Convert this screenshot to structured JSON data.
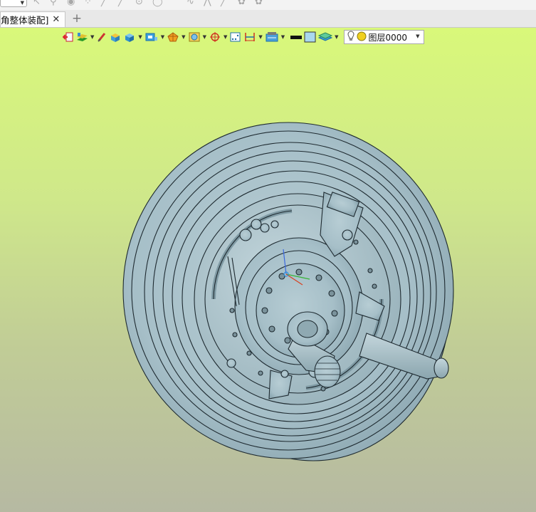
{
  "tabs": {
    "active_label": "角整体装配]",
    "close_glyph": "✕",
    "new_tab_glyph": "+"
  },
  "view_toolbar": {
    "buttons": [
      {
        "name": "exit-sketch-icon"
      },
      {
        "name": "layer-manager-icon",
        "dropdown": true
      },
      {
        "name": "eraser-icon"
      },
      {
        "name": "solid-box-icon"
      },
      {
        "name": "view-cube-icon",
        "dropdown": true
      },
      {
        "name": "display-style-icon",
        "dropdown": true
      },
      {
        "name": "render-mode-icon",
        "dropdown": true
      },
      {
        "name": "section-view-icon",
        "dropdown": true
      },
      {
        "name": "snap-point-icon",
        "dropdown": true
      },
      {
        "name": "grid-toggle-icon"
      },
      {
        "name": "dimension-icon",
        "dropdown": true
      },
      {
        "name": "layer-filter-icon",
        "dropdown": true
      },
      {
        "name": "line-color-icon"
      },
      {
        "name": "face-color-icon"
      },
      {
        "name": "workplane-icon",
        "dropdown": true
      }
    ],
    "layer": {
      "name": "图层0000",
      "bulb_icon": "bulb-icon",
      "color_icon": "layer-color-icon"
    }
  },
  "colors": {
    "viewport_top": "#d9f87a",
    "viewport_bottom": "#b6b9a2",
    "model_fill": "#a9c2cb",
    "model_edge": "#1e2a30"
  }
}
